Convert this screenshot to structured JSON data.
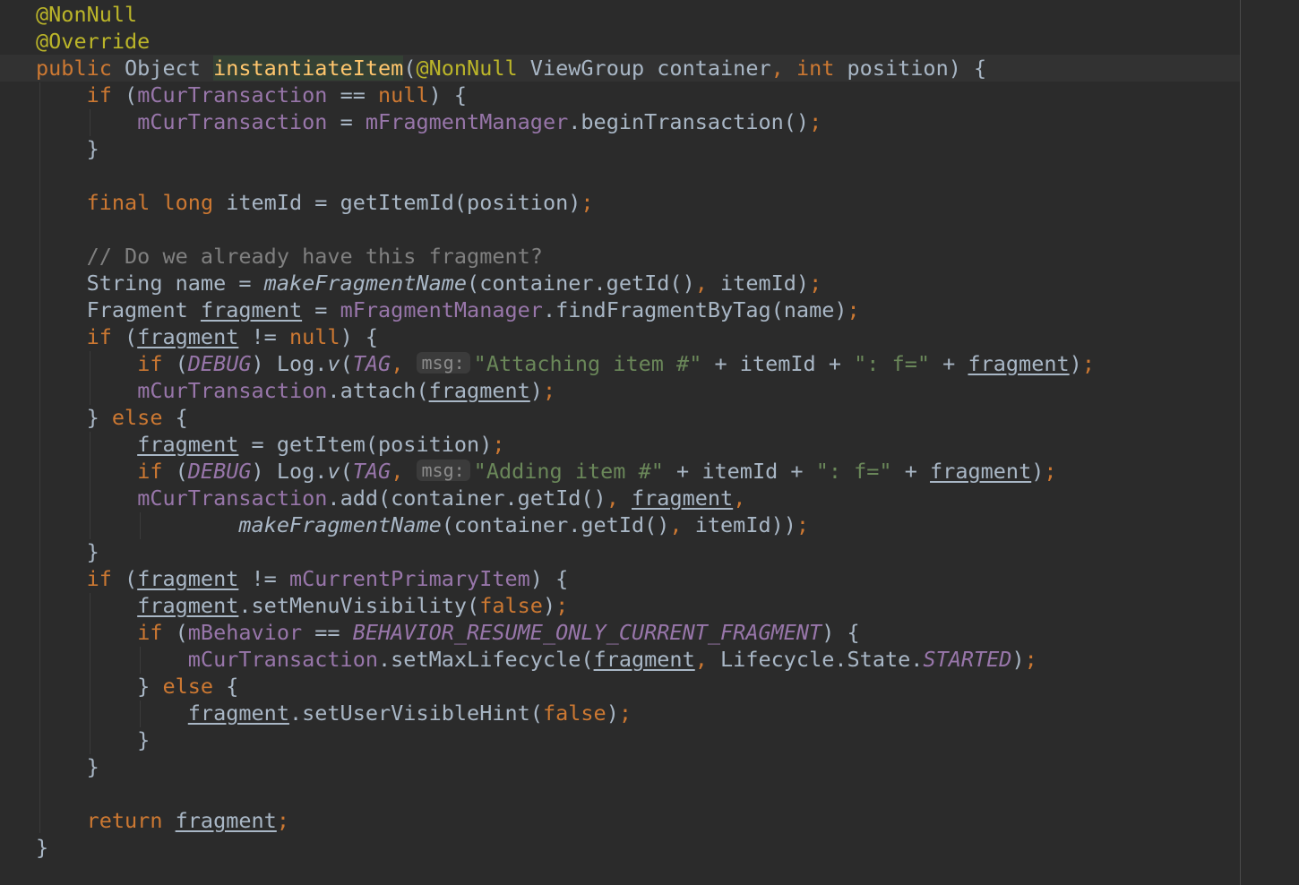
{
  "editor": {
    "colors": {
      "background": "#2b2b2b",
      "current_line": "#323232",
      "keyword": "#cc7832",
      "annotation": "#bbb529",
      "field": "#9876aa",
      "string": "#6a8759",
      "comment": "#808080",
      "method_declaration": "#ffc66d",
      "default_text": "#a9b7c6"
    },
    "lines": [
      [
        {
          "t": "@NonNull",
          "c": "anno"
        }
      ],
      [
        {
          "t": "@Override",
          "c": "anno"
        }
      ],
      [
        {
          "t": "public",
          "c": "key"
        },
        {
          "t": " Object "
        },
        {
          "t": "instantiateItem",
          "c": "fn decl-hl"
        },
        {
          "t": "("
        },
        {
          "t": "@NonNull",
          "c": "anno"
        },
        {
          "t": " ViewGroup container"
        },
        {
          "t": ",",
          "c": "key"
        },
        {
          "t": " "
        },
        {
          "t": "int",
          "c": "key"
        },
        {
          "t": " position) {"
        }
      ],
      [
        {
          "t": "    "
        },
        {
          "t": "if",
          "c": "key"
        },
        {
          "t": " ("
        },
        {
          "t": "mCurTransaction",
          "c": "fld"
        },
        {
          "t": " == "
        },
        {
          "t": "null",
          "c": "key"
        },
        {
          "t": ") {"
        }
      ],
      [
        {
          "t": "        "
        },
        {
          "t": "mCurTransaction",
          "c": "fld"
        },
        {
          "t": " = "
        },
        {
          "t": "mFragmentManager",
          "c": "fld"
        },
        {
          "t": ".beginTransaction()"
        },
        {
          "t": ";",
          "c": "key"
        }
      ],
      [
        {
          "t": "    }"
        }
      ],
      [],
      [
        {
          "t": "    "
        },
        {
          "t": "final",
          "c": "key"
        },
        {
          "t": " "
        },
        {
          "t": "long",
          "c": "key"
        },
        {
          "t": " itemId = getItemId(position)"
        },
        {
          "t": ";",
          "c": "key"
        }
      ],
      [],
      [
        {
          "t": "    "
        },
        {
          "t": "// Do we already have this fragment?",
          "c": "cmt"
        }
      ],
      [
        {
          "t": "    String name = "
        },
        {
          "t": "makeFragmentName",
          "c": "it"
        },
        {
          "t": "(container.getId()"
        },
        {
          "t": ",",
          "c": "key"
        },
        {
          "t": " itemId)"
        },
        {
          "t": ";",
          "c": "key"
        }
      ],
      [
        {
          "t": "    Fragment "
        },
        {
          "t": "fragment",
          "c": "var"
        },
        {
          "t": " = "
        },
        {
          "t": "mFragmentManager",
          "c": "fld"
        },
        {
          "t": ".findFragmentByTag(name)"
        },
        {
          "t": ";",
          "c": "key"
        }
      ],
      [
        {
          "t": "    "
        },
        {
          "t": "if",
          "c": "key"
        },
        {
          "t": " ("
        },
        {
          "t": "fragment",
          "c": "var"
        },
        {
          "t": " != "
        },
        {
          "t": "null",
          "c": "key"
        },
        {
          "t": ") {"
        }
      ],
      [
        {
          "t": "        "
        },
        {
          "t": "if",
          "c": "key"
        },
        {
          "t": " ("
        },
        {
          "t": "DEBUG",
          "c": "fld-it"
        },
        {
          "t": ") Log."
        },
        {
          "t": "v",
          "c": "it"
        },
        {
          "t": "("
        },
        {
          "t": "TAG",
          "c": "fld-it"
        },
        {
          "t": ",",
          "c": "key"
        },
        {
          "t": " "
        },
        {
          "t": "msg:",
          "c": "hint"
        },
        {
          "t": "\"Attaching item #\"",
          "c": "str"
        },
        {
          "t": " + itemId + "
        },
        {
          "t": "\": f=\"",
          "c": "str"
        },
        {
          "t": " + "
        },
        {
          "t": "fragment",
          "c": "var"
        },
        {
          "t": ")"
        },
        {
          "t": ";",
          "c": "key"
        }
      ],
      [
        {
          "t": "        "
        },
        {
          "t": "mCurTransaction",
          "c": "fld"
        },
        {
          "t": ".attach("
        },
        {
          "t": "fragment",
          "c": "var"
        },
        {
          "t": ")"
        },
        {
          "t": ";",
          "c": "key"
        }
      ],
      [
        {
          "t": "    } "
        },
        {
          "t": "else",
          "c": "key"
        },
        {
          "t": " {"
        }
      ],
      [
        {
          "t": "        "
        },
        {
          "t": "fragment",
          "c": "var"
        },
        {
          "t": " = getItem(position)"
        },
        {
          "t": ";",
          "c": "key"
        }
      ],
      [
        {
          "t": "        "
        },
        {
          "t": "if",
          "c": "key"
        },
        {
          "t": " ("
        },
        {
          "t": "DEBUG",
          "c": "fld-it"
        },
        {
          "t": ") Log."
        },
        {
          "t": "v",
          "c": "it"
        },
        {
          "t": "("
        },
        {
          "t": "TAG",
          "c": "fld-it"
        },
        {
          "t": ",",
          "c": "key"
        },
        {
          "t": " "
        },
        {
          "t": "msg:",
          "c": "hint"
        },
        {
          "t": "\"Adding item #\"",
          "c": "str"
        },
        {
          "t": " + itemId + "
        },
        {
          "t": "\": f=\"",
          "c": "str"
        },
        {
          "t": " + "
        },
        {
          "t": "fragment",
          "c": "var"
        },
        {
          "t": ")"
        },
        {
          "t": ";",
          "c": "key"
        }
      ],
      [
        {
          "t": "        "
        },
        {
          "t": "mCurTransaction",
          "c": "fld"
        },
        {
          "t": ".add(container.getId()"
        },
        {
          "t": ",",
          "c": "key"
        },
        {
          "t": " "
        },
        {
          "t": "fragment",
          "c": "var"
        },
        {
          "t": ",",
          "c": "key"
        }
      ],
      [
        {
          "t": "                "
        },
        {
          "t": "makeFragmentName",
          "c": "it"
        },
        {
          "t": "(container.getId()"
        },
        {
          "t": ",",
          "c": "key"
        },
        {
          "t": " itemId))"
        },
        {
          "t": ";",
          "c": "key"
        }
      ],
      [
        {
          "t": "    }"
        }
      ],
      [
        {
          "t": "    "
        },
        {
          "t": "if",
          "c": "key"
        },
        {
          "t": " ("
        },
        {
          "t": "fragment",
          "c": "var"
        },
        {
          "t": " != "
        },
        {
          "t": "mCurrentPrimaryItem",
          "c": "fld"
        },
        {
          "t": ") {"
        }
      ],
      [
        {
          "t": "        "
        },
        {
          "t": "fragment",
          "c": "var"
        },
        {
          "t": ".setMenuVisibility("
        },
        {
          "t": "false",
          "c": "key"
        },
        {
          "t": ")"
        },
        {
          "t": ";",
          "c": "key"
        }
      ],
      [
        {
          "t": "        "
        },
        {
          "t": "if",
          "c": "key"
        },
        {
          "t": " ("
        },
        {
          "t": "mBehavior",
          "c": "fld"
        },
        {
          "t": " == "
        },
        {
          "t": "BEHAVIOR_RESUME_ONLY_CURRENT_FRAGMENT",
          "c": "fld-it"
        },
        {
          "t": ") {"
        }
      ],
      [
        {
          "t": "            "
        },
        {
          "t": "mCurTransaction",
          "c": "fld"
        },
        {
          "t": ".setMaxLifecycle("
        },
        {
          "t": "fragment",
          "c": "var"
        },
        {
          "t": ",",
          "c": "key"
        },
        {
          "t": " Lifecycle.State."
        },
        {
          "t": "STARTED",
          "c": "fld-it"
        },
        {
          "t": ")"
        },
        {
          "t": ";",
          "c": "key"
        }
      ],
      [
        {
          "t": "        } "
        },
        {
          "t": "else",
          "c": "key"
        },
        {
          "t": " {"
        }
      ],
      [
        {
          "t": "            "
        },
        {
          "t": "fragment",
          "c": "var"
        },
        {
          "t": ".setUserVisibleHint("
        },
        {
          "t": "false",
          "c": "key"
        },
        {
          "t": ")"
        },
        {
          "t": ";",
          "c": "key"
        }
      ],
      [
        {
          "t": "        }"
        }
      ],
      [
        {
          "t": "    }"
        }
      ],
      [],
      [
        {
          "t": "    "
        },
        {
          "t": "return",
          "c": "key"
        },
        {
          "t": " "
        },
        {
          "t": "fragment",
          "c": "var"
        },
        {
          "t": ";",
          "c": "key"
        }
      ],
      [
        {
          "t": "}"
        }
      ]
    ]
  }
}
